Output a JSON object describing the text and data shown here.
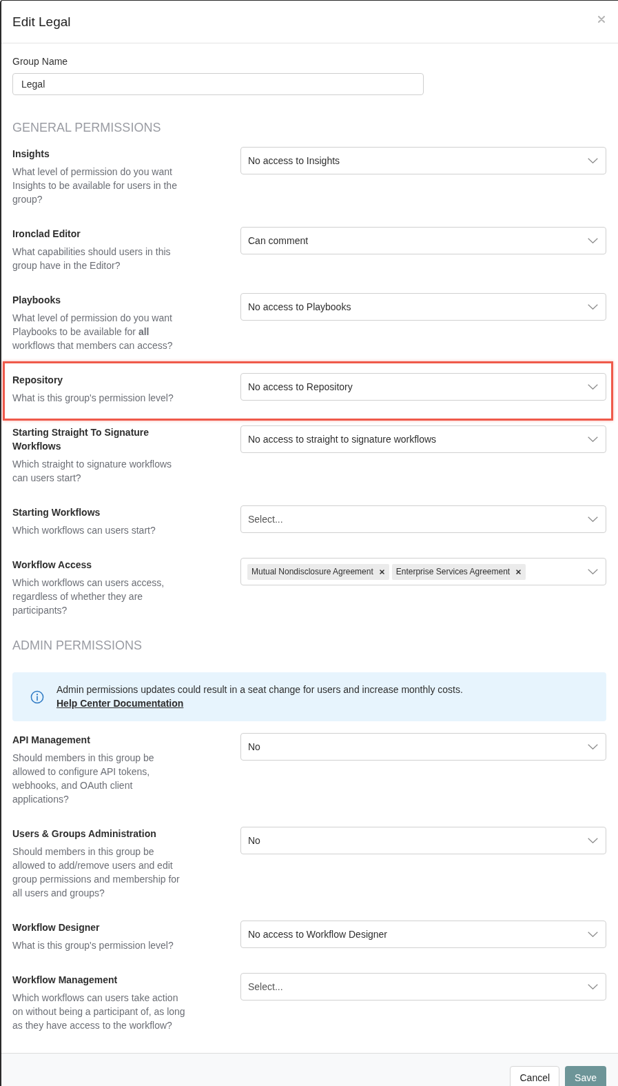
{
  "modal": {
    "title": "Edit Legal"
  },
  "group_name": {
    "label": "Group Name",
    "value": "Legal"
  },
  "sections": [
    {
      "heading": "GENERAL PERMISSIONS",
      "fields": [
        {
          "kind": "select",
          "label": "Insights",
          "description": "What level of permission do you want Insights to be available for users in the group?",
          "value": "No access to Insights",
          "highlighted": false
        },
        {
          "kind": "select",
          "label": "Ironclad Editor",
          "description": "What capabilities should users in this group have in the Editor?",
          "value": "Can comment",
          "highlighted": false
        },
        {
          "kind": "select",
          "label": "Playbooks",
          "description": "What level of permission do you want Playbooks to be available for **all** workflows that members can access?",
          "value": "No access to Playbooks",
          "highlighted": false
        },
        {
          "kind": "select",
          "label": "Repository",
          "description": "What is this group's permission level?",
          "value": "No access to Repository",
          "highlighted": true
        },
        {
          "kind": "select",
          "label": "Starting Straight To Signature Workflows",
          "description": "Which straight to signature workflows can users start?",
          "value": "No access to straight to signature workflows",
          "highlighted": false
        },
        {
          "kind": "select",
          "label": "Starting Workflows",
          "description": "Which workflows can users start?",
          "placeholder": "Select...",
          "highlighted": false
        },
        {
          "kind": "multiselect",
          "label": "Workflow Access",
          "description": "Which workflows can users access, regardless of whether they are participants?",
          "tags": [
            "Mutual Nondisclosure Agreement",
            "Enterprise Services Agreement"
          ],
          "highlighted": false
        }
      ]
    },
    {
      "heading": "ADMIN PERMISSIONS",
      "notice": {
        "text": "Admin permissions updates could result in a seat change for users and increase monthly costs.",
        "link": "Help Center Documentation"
      },
      "fields": [
        {
          "kind": "select",
          "label": "API Management",
          "description": "Should members in this group be allowed to configure API tokens, webhooks, and OAuth client applications?",
          "value": "No",
          "highlighted": false
        },
        {
          "kind": "select",
          "label": "Users & Groups Administration",
          "description": "Should members in this group be allowed to add/remove users and edit group permissions and membership for all users and groups?",
          "value": "No",
          "highlighted": false
        },
        {
          "kind": "select",
          "label": "Workflow Designer",
          "description": "What is this group's permission level?",
          "value": "No access to Workflow Designer",
          "highlighted": false
        },
        {
          "kind": "select",
          "label": "Workflow Management",
          "description": "Which workflows can users take action on without being a participant of, as long as they have access to the workflow?",
          "placeholder": "Select...",
          "highlighted": false
        }
      ]
    }
  ],
  "footer": {
    "buttons": [
      {
        "label": "Cancel",
        "kind": "secondary"
      },
      {
        "label": "Save",
        "kind": "primary"
      }
    ]
  }
}
